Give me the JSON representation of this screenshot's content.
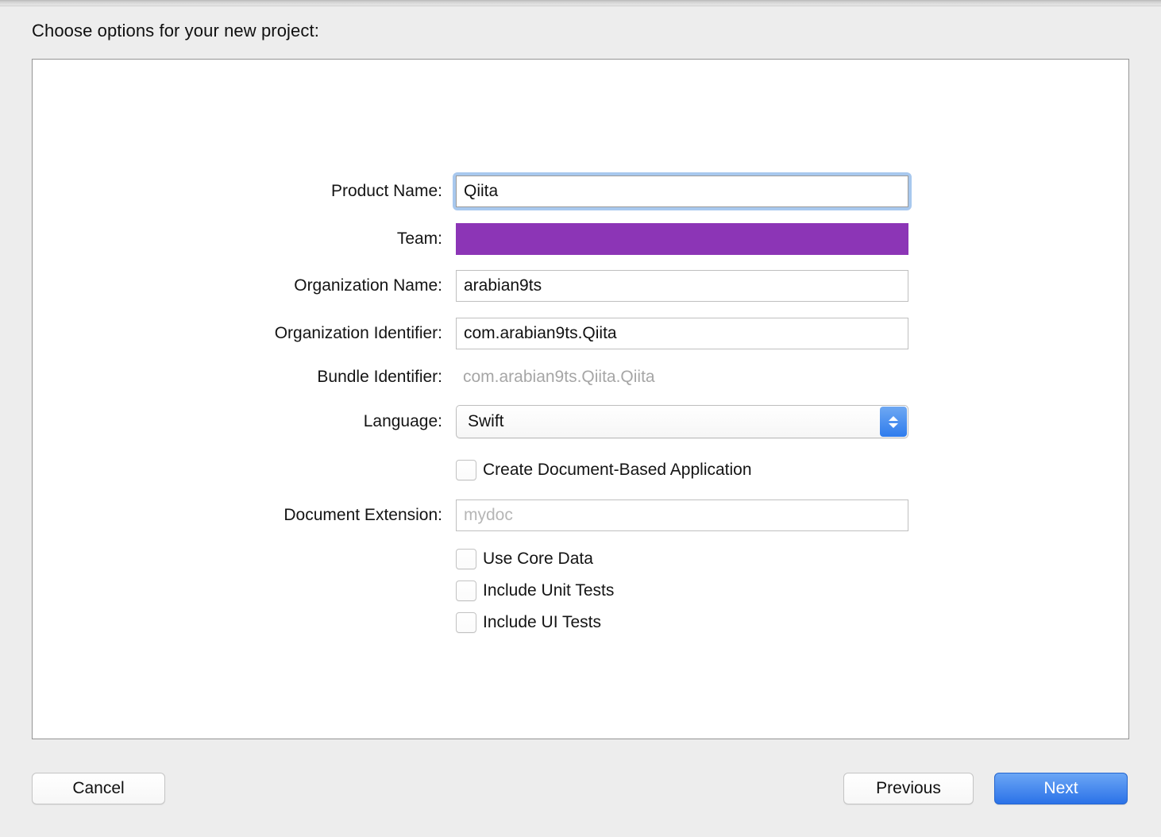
{
  "window": {
    "heading": "Choose options for your new project:"
  },
  "form": {
    "rows": [
      {
        "label": "Product Name:",
        "value": "Qiita",
        "type": "text-focused"
      },
      {
        "label": "Team:",
        "value": "",
        "type": "redacted",
        "redaction_color": "#8c35b6"
      },
      {
        "label": "Organization Name:",
        "value": "arabian9ts",
        "type": "text"
      },
      {
        "label": "Organization Identifier:",
        "value": "com.arabian9ts.Qiita",
        "type": "text"
      },
      {
        "label": "Bundle Identifier:",
        "value": "com.arabian9ts.Qiita.Qiita",
        "type": "static"
      },
      {
        "label": "Language:",
        "value": "Swift",
        "type": "popup"
      },
      {
        "label": "Document Extension:",
        "value": "",
        "placeholder": "mydoc",
        "type": "text"
      }
    ]
  },
  "checkboxes": [
    {
      "label": "Create Document-Based Application",
      "checked": false
    },
    {
      "label": "Use Core Data",
      "checked": false
    },
    {
      "label": "Include Unit Tests",
      "checked": false
    },
    {
      "label": "Include UI Tests",
      "checked": false
    }
  ],
  "buttons": {
    "cancel": "Cancel",
    "previous": "Previous",
    "next": "Next"
  },
  "colors": {
    "accent_blue": "#2b72e8",
    "focus_ring": "#a8c8ee",
    "redaction_purple": "#8c35b6",
    "panel_background": "#ffffff",
    "window_background": "#ededed"
  }
}
